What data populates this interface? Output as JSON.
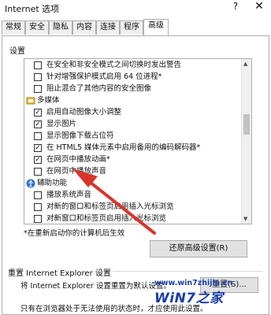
{
  "window": {
    "title": "Internet 选项",
    "help_label": "?",
    "close_label": "✕"
  },
  "tabs": [
    {
      "label": "常规"
    },
    {
      "label": "安全"
    },
    {
      "label": "隐私"
    },
    {
      "label": "内容"
    },
    {
      "label": "连接"
    },
    {
      "label": "程序"
    },
    {
      "label": "高级"
    }
  ],
  "active_tab": "高级",
  "settings": {
    "label": "设置",
    "rows": [
      {
        "type": "item",
        "checked": false,
        "label": "在安全和非安全模式之间切换时发出警告"
      },
      {
        "type": "item",
        "checked": false,
        "label": "针对增强保护模式启用 64 位进程*"
      },
      {
        "type": "item",
        "checked": false,
        "label": "阻止混合了其他内容的安全图像"
      },
      {
        "type": "group",
        "icon": "multimedia-icon",
        "label": "多媒体"
      },
      {
        "type": "item",
        "checked": true,
        "label": "启用自动图像大小调整"
      },
      {
        "type": "item",
        "checked": true,
        "label": "显示图片"
      },
      {
        "type": "item",
        "checked": false,
        "label": "显示图像下载占位符"
      },
      {
        "type": "item",
        "checked": true,
        "label": "在 HTML5 媒体元素中启用备用的编码解码器*"
      },
      {
        "type": "item",
        "checked": true,
        "label": "在网页中播放动画*"
      },
      {
        "type": "item",
        "checked": false,
        "label": "在网页中播放声音"
      },
      {
        "type": "group",
        "icon": "accessibility-icon",
        "label": "辅助功能"
      },
      {
        "type": "item",
        "checked": false,
        "label": "播放系统声音"
      },
      {
        "type": "item",
        "checked": false,
        "label": "对新的窗口和标签页启用插入光标浏览"
      },
      {
        "type": "item",
        "checked": false,
        "label": "对新窗口和标签页启用插入光标浏览"
      }
    ]
  },
  "restart_note": "*在重新启动你的计算机后生效",
  "restore_button": "还原高级设置(R)",
  "reset": {
    "group_label": "重置 Internet Explorer 设置",
    "description": "将 Internet Explorer 设置重置为默认设置。",
    "button": "重置(S)...",
    "note": "只有在浏览器处于无法使用的状态时，才应使用此设置。"
  },
  "watermark": {
    "url": "www.win7zhijia.cn",
    "logo": "WiN7之家"
  },
  "colors": {
    "arrow": "#d9342b",
    "accent": "#1a3ea8",
    "checkbox_border": "#333333"
  }
}
